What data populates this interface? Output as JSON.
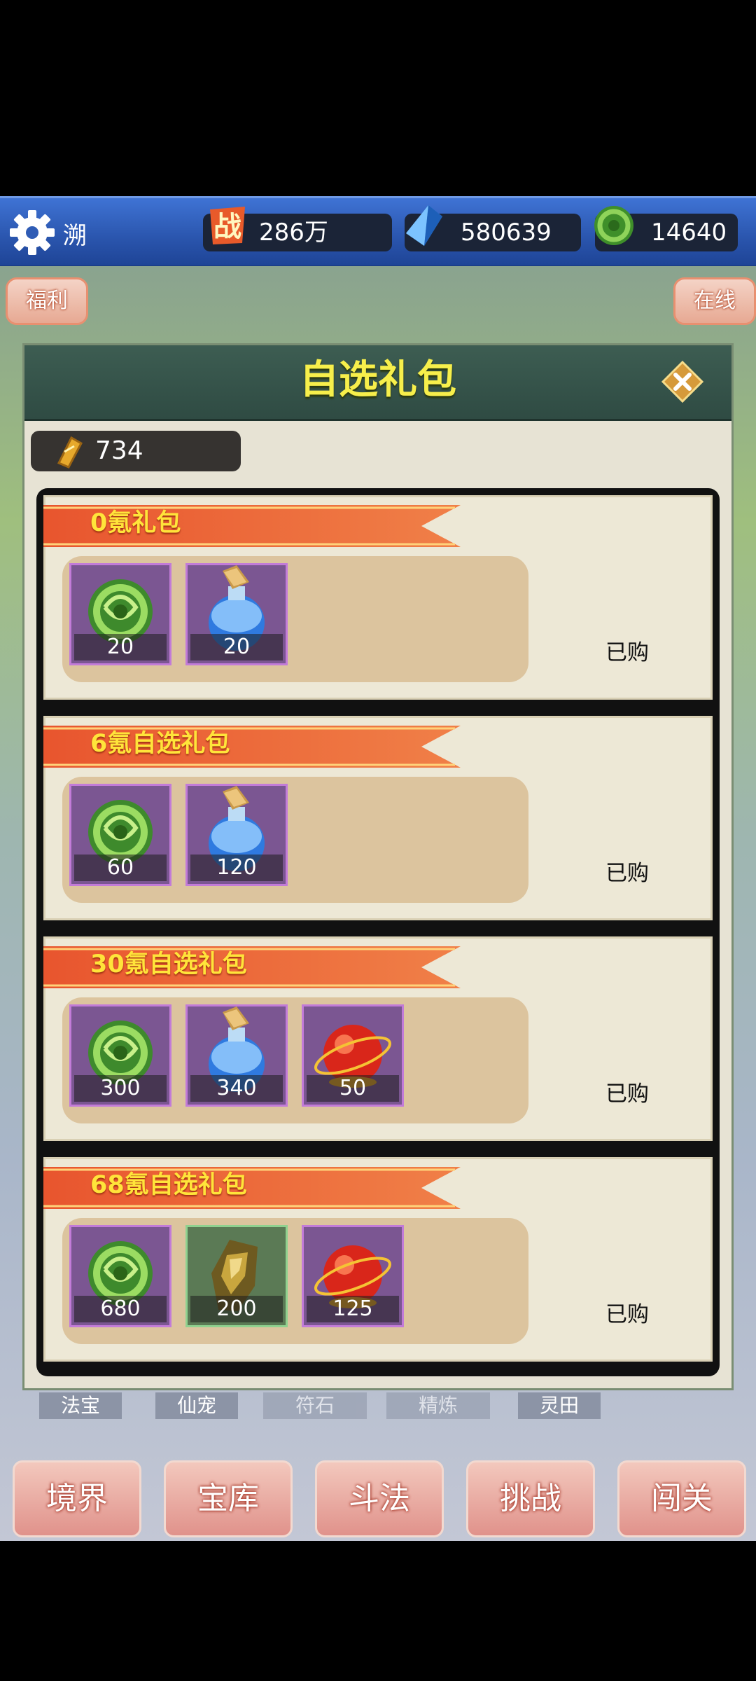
{
  "topbar": {
    "player_name": "溯",
    "power_icon_text": "战",
    "power": "286万",
    "crystals": "580639",
    "jade": "14640"
  },
  "side_buttons": {
    "welfare": "福利",
    "online": "在线"
  },
  "dialog": {
    "title": "自选礼包",
    "coupon_count": "734",
    "packs": [
      {
        "name": "0氪礼包",
        "items": [
          {
            "icon": "jade-icon",
            "qty": "20"
          },
          {
            "icon": "potion-icon",
            "qty": "20"
          }
        ],
        "status": "已购"
      },
      {
        "name": "6氪自选礼包",
        "items": [
          {
            "icon": "jade-icon",
            "qty": "60"
          },
          {
            "icon": "potion-icon",
            "qty": "120"
          }
        ],
        "status": "已购"
      },
      {
        "name": "30氪自选礼包",
        "items": [
          {
            "icon": "jade-icon",
            "qty": "300"
          },
          {
            "icon": "potion-icon",
            "qty": "340"
          },
          {
            "icon": "red-orb-icon",
            "qty": "50"
          }
        ],
        "status": "已购"
      },
      {
        "name": "68氪自选礼包",
        "items": [
          {
            "icon": "jade-icon",
            "qty": "680"
          },
          {
            "icon": "gold-ore-icon",
            "qty": "200"
          },
          {
            "icon": "red-orb-icon",
            "qty": "125"
          }
        ],
        "status": "已购"
      }
    ]
  },
  "subtabs": [
    "法宝",
    "仙宠",
    "符石",
    "精炼",
    "灵田"
  ],
  "bottom_nav": [
    "境界",
    "宝库",
    "斗法",
    "挑战",
    "闯关"
  ],
  "colors": {
    "title_yellow": "#f7ef4b",
    "banner_orange": "#ea6a3a",
    "topbar_blue": "#2a55ad"
  }
}
